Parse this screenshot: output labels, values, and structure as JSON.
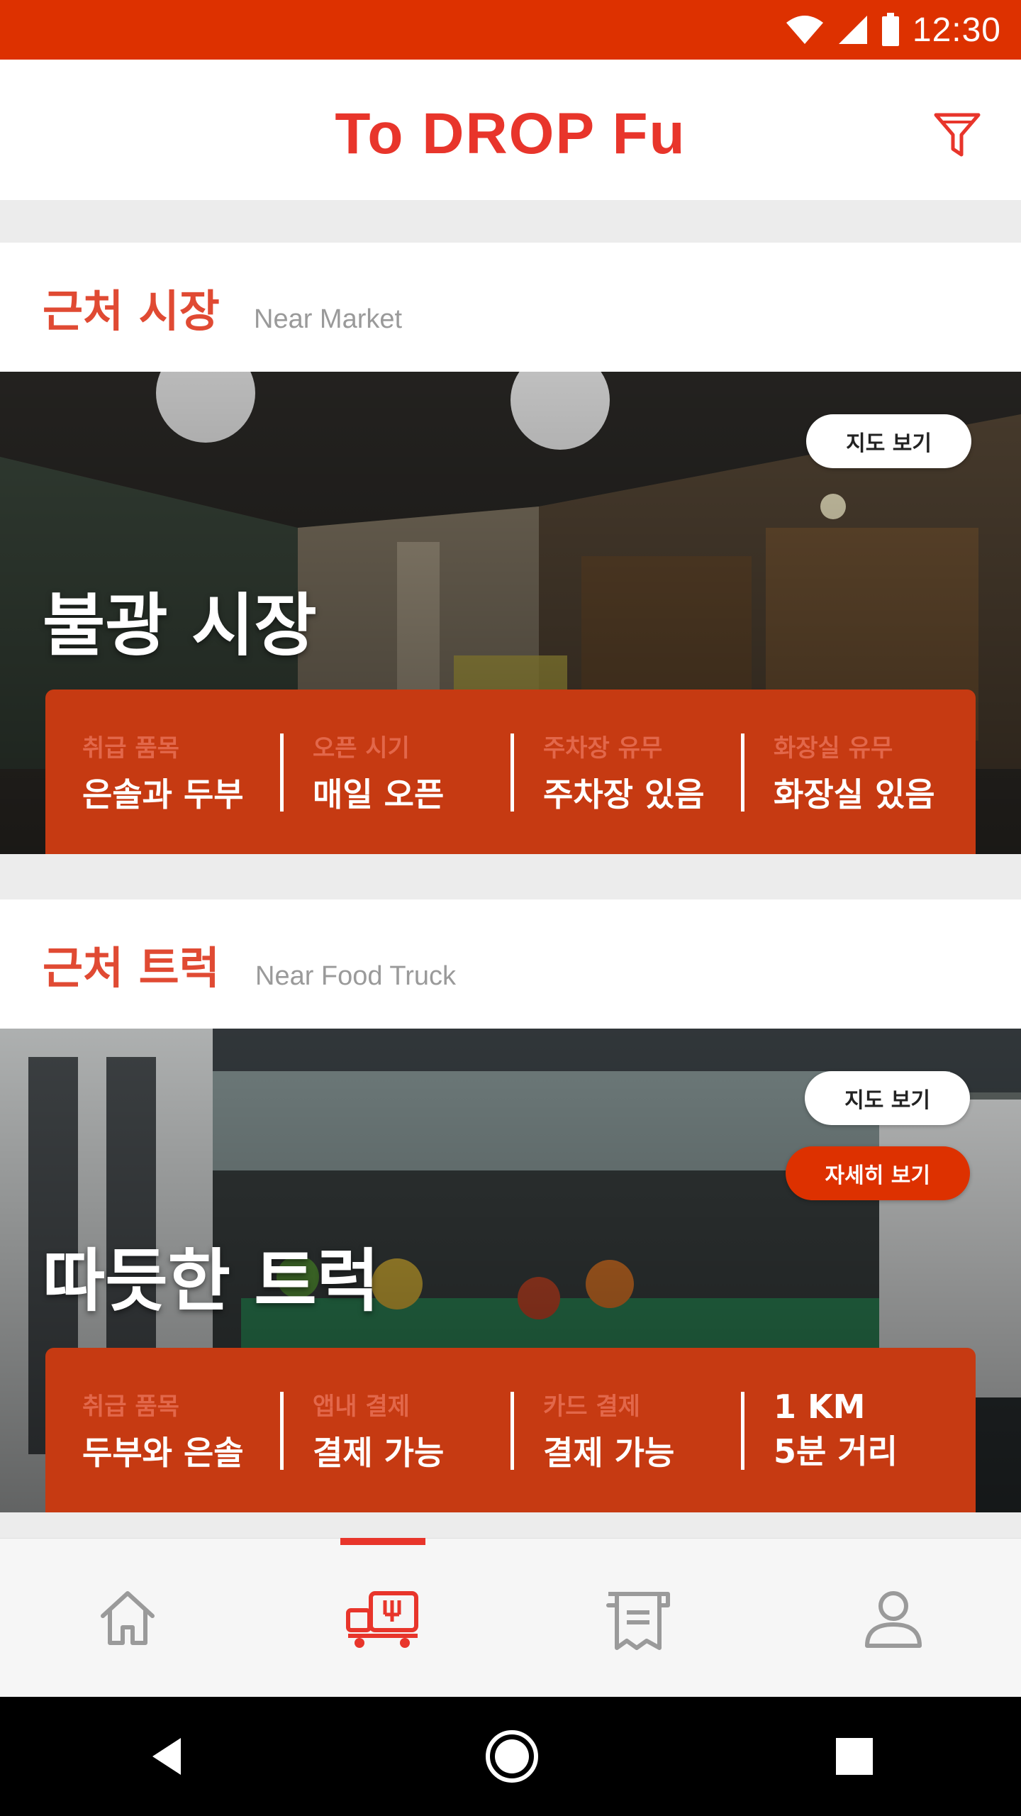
{
  "status_bar": {
    "time": "12:30",
    "bg_color": "#dd3100"
  },
  "app_bar": {
    "logo_text": "To DROP Fu",
    "filter_icon": "filter-icon",
    "brand_color": "#e8352b"
  },
  "market_section": {
    "title": "근처 시장",
    "subtitle": "Near Market",
    "card": {
      "name": "불광 시장",
      "map_button": "지도 보기",
      "info": [
        {
          "label": "취급 품목",
          "value": "은솔과 두부"
        },
        {
          "label": "오픈 시기",
          "value": "매일 오픈"
        },
        {
          "label": "주차장 유무",
          "value": "주차장 있음"
        },
        {
          "label": "화장실 유무",
          "value": "화장실 있음"
        }
      ]
    }
  },
  "truck_section": {
    "title": "근처 트럭",
    "subtitle": "Near Food Truck",
    "card": {
      "name": "따듯한 트럭",
      "map_button": "지도 보기",
      "detail_button": "자세히 보기",
      "info": [
        {
          "label": "취급 품목",
          "value": "두부와 은솔"
        },
        {
          "label": "앱내 결제",
          "value": "결제 가능"
        },
        {
          "label": "카드 결제",
          "value": "결제 가능"
        },
        {
          "label": "1 KM",
          "value": "5분 거리"
        }
      ]
    }
  },
  "bottom_nav": {
    "items": [
      {
        "icon": "home-icon",
        "active": false
      },
      {
        "icon": "market-stall-icon",
        "active": true
      },
      {
        "icon": "receipt-icon",
        "active": false
      },
      {
        "icon": "profile-icon",
        "active": false
      }
    ]
  },
  "system_nav": {
    "back": "back-icon",
    "home": "home-circle-icon",
    "recents": "recents-icon"
  }
}
